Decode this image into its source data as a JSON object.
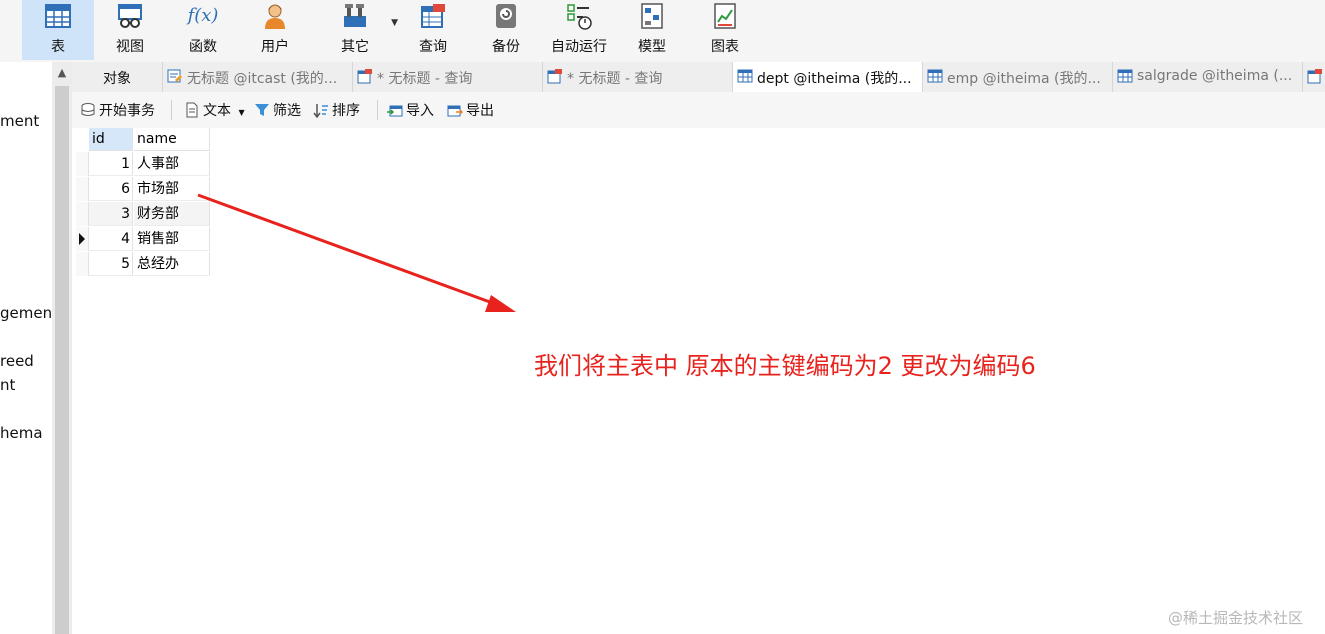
{
  "ribbon": {
    "items": [
      {
        "label": "表",
        "icon": "table-icon",
        "active": true
      },
      {
        "label": "视图",
        "icon": "view-icon"
      },
      {
        "label": "函数",
        "icon": "function-icon",
        "symbol": "f(x)"
      },
      {
        "label": "用户",
        "icon": "user-icon"
      },
      {
        "label": "其它",
        "icon": "tools-icon"
      },
      {
        "label": "查询",
        "icon": "query-icon"
      },
      {
        "label": "备份",
        "icon": "backup-icon"
      },
      {
        "label": "自动运行",
        "icon": "automation-icon"
      },
      {
        "label": "模型",
        "icon": "model-icon"
      },
      {
        "label": "图表",
        "icon": "chart-icon"
      }
    ]
  },
  "navigator": {
    "items": [
      "ment",
      "gement",
      "reed",
      "nt",
      "hema"
    ]
  },
  "tabs": [
    {
      "label": "对象"
    },
    {
      "label": "无标题 @itcast (我的..."
    },
    {
      "label": "* 无标题 - 查询"
    },
    {
      "label": "* 无标题 - 查询"
    },
    {
      "label": "dept @itheima (我的..."
    },
    {
      "label": "emp @itheima (我的..."
    },
    {
      "label": "salgrade @itheima (..."
    }
  ],
  "subtoolbar": {
    "begin_transaction": "开始事务",
    "text": "文本",
    "filter": "筛选",
    "sort": "排序",
    "import": "导入",
    "export": "导出"
  },
  "grid": {
    "columns": [
      "id",
      "name"
    ],
    "rows": [
      {
        "id": "1",
        "name": "人事部"
      },
      {
        "id": "6",
        "name": "市场部"
      },
      {
        "id": "3",
        "name": "财务部"
      },
      {
        "id": "4",
        "name": "销售部"
      },
      {
        "id": "5",
        "name": "总经办"
      }
    ]
  },
  "annotation": "我们将主表中 原本的主键编码为2 更改为编码6",
  "watermark": "@稀土掘金技术社区",
  "colors": {
    "accent": "#cfe4f8",
    "annotation": "#e8231d"
  }
}
